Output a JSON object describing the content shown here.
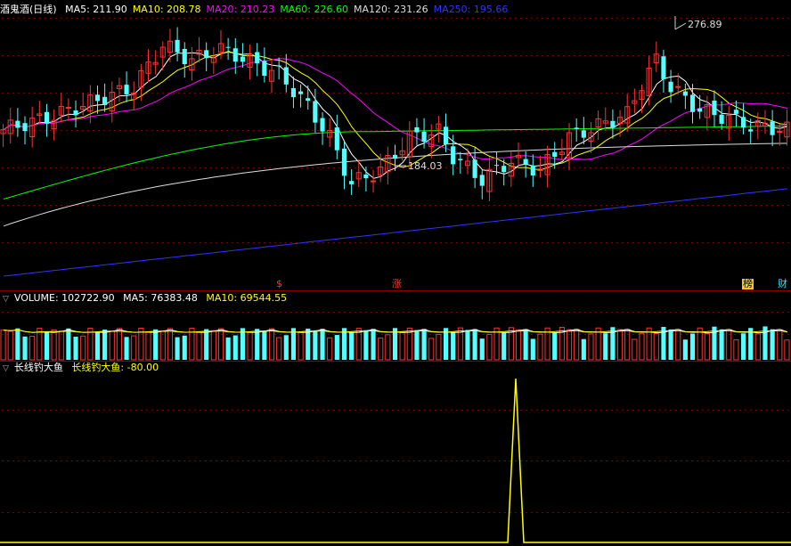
{
  "price_panel": {
    "title": "酒鬼酒(日线)",
    "ma_labels": [
      {
        "text": "MA5: 211.90",
        "color": "#ffffff"
      },
      {
        "text": "MA10: 208.78",
        "color": "#ffff00"
      },
      {
        "text": "MA20: 210.23",
        "color": "#ff00ff"
      },
      {
        "text": "MA60: 226.60",
        "color": "#00ff00"
      },
      {
        "text": "MA120: 231.26",
        "color": "#dddddd"
      },
      {
        "text": "MA250: 195.66",
        "color": "#3333ff"
      }
    ],
    "high_marker": "276.89",
    "low_marker": "184.03",
    "events": [
      {
        "label": "$",
        "color": "#ff3333"
      },
      {
        "label": "涨",
        "color": "#ff3333"
      },
      {
        "label": "榜",
        "color": "#ffff00"
      },
      {
        "label": "财",
        "color": "#00ffff"
      }
    ]
  },
  "volume_panel": {
    "title": "VOLUME: 102722.90",
    "ma5": "MA5: 76383.48",
    "ma10": "MA10: 69544.55",
    "ma5_color": "#ffffff",
    "ma10_color": "#ffff00"
  },
  "indicator_panel": {
    "name": "长线钓大鱼",
    "value_label": "长线钓大鱼: -80.00",
    "value_color": "#ffff00"
  },
  "colors": {
    "up": "#ff3232",
    "down": "#54ffff",
    "grid": "#7a0000"
  }
}
